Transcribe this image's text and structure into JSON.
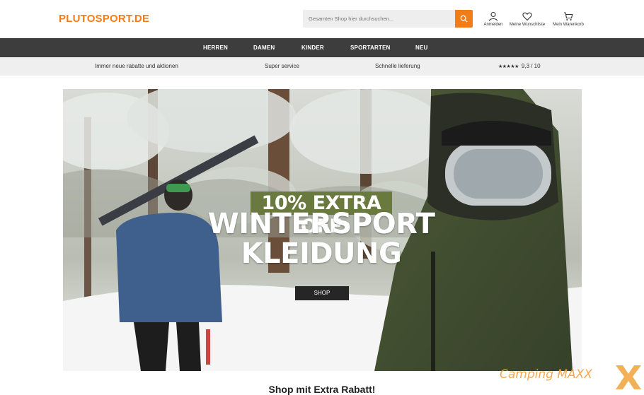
{
  "header": {
    "logo": "PLUTOSPORT.DE",
    "search_placeholder": "Gesamten Shop hier durchsuchen...",
    "actions": [
      {
        "label": "Anmelden",
        "icon": "user-icon"
      },
      {
        "label": "Meine Wunschliste",
        "icon": "heart-icon"
      },
      {
        "label": "Mein Warenkorb",
        "icon": "cart-icon"
      }
    ]
  },
  "nav": {
    "items": [
      "HERREN",
      "DAMEN",
      "KINDER",
      "SPORTARTEN",
      "NEU"
    ]
  },
  "usp": {
    "items": [
      "Immer neue rabatte und aktionen",
      "Super service",
      "Schnelle lieferung"
    ],
    "rating_stars": "★★★★★",
    "rating": "9,3 / 10"
  },
  "hero": {
    "badge": "10% EXTRA OFF",
    "title_line1": "WINTERSPORT",
    "title_line2": "KLEIDUNG",
    "button": "SHOP"
  },
  "section": {
    "title": "Shop mit Extra Rabatt!"
  },
  "watermark": {
    "text": "Camping MAXX"
  },
  "colors": {
    "accent": "#f07d1a",
    "nav_bg": "#3d3d3d",
    "usp_bg": "#efefef",
    "badge_bg": "#6a7a3f"
  }
}
